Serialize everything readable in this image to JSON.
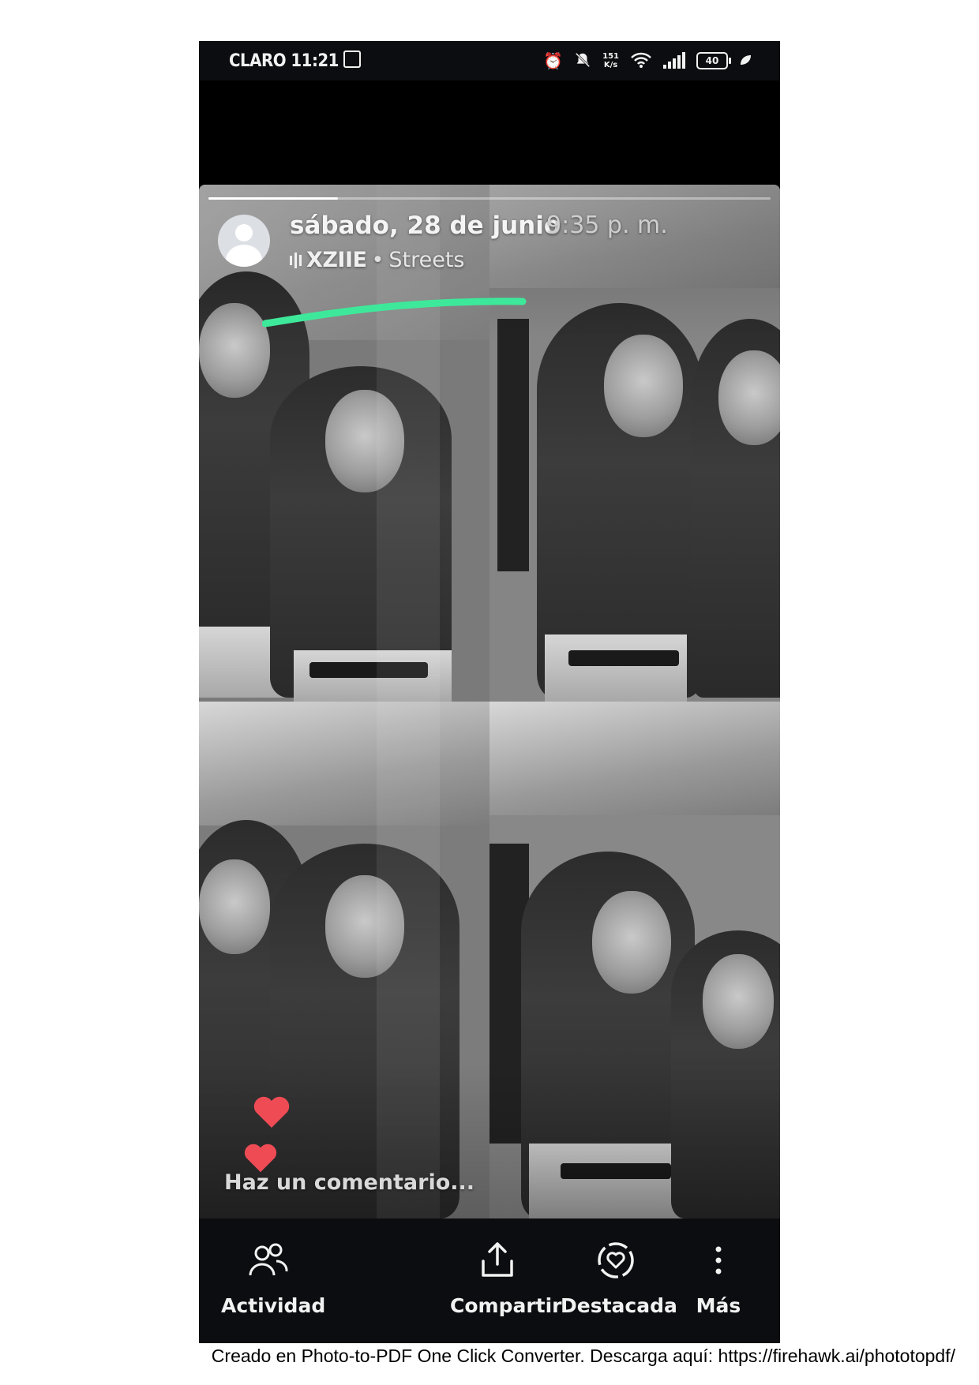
{
  "status_bar": {
    "carrier_time": "CLARO 11:21",
    "net_speed_value": "151",
    "net_speed_unit": "K/s",
    "battery": "40",
    "icons": [
      "alarm-icon",
      "mute-icon",
      "wifi-icon",
      "signal-icon",
      "battery-icon",
      "leaf-icon"
    ]
  },
  "story": {
    "progress": 0.23,
    "date": "sábado, 28 de junio",
    "time": "9:35 p. m.",
    "music_artist": "XZIIE",
    "music_separator": "•",
    "music_song": "Streets",
    "comment_placeholder": "Haz un comentario..."
  },
  "actions": [
    {
      "label": "Actividad",
      "icon": "people-icon"
    },
    {
      "label": "Compartir",
      "icon": "share-icon"
    },
    {
      "label": "Destacada",
      "icon": "highlight-heart-icon"
    },
    {
      "label": "Más",
      "icon": "more-vertical-icon"
    }
  ],
  "colors": {
    "highlighter": "#3ee89a",
    "heart": "#ee4b55",
    "background_dark": "#0c0d10"
  },
  "footer": {
    "note": "Creado en Photo-to-PDF One Click Converter. Descarga aquí: https://firehawk.ai/phototopdf/"
  }
}
